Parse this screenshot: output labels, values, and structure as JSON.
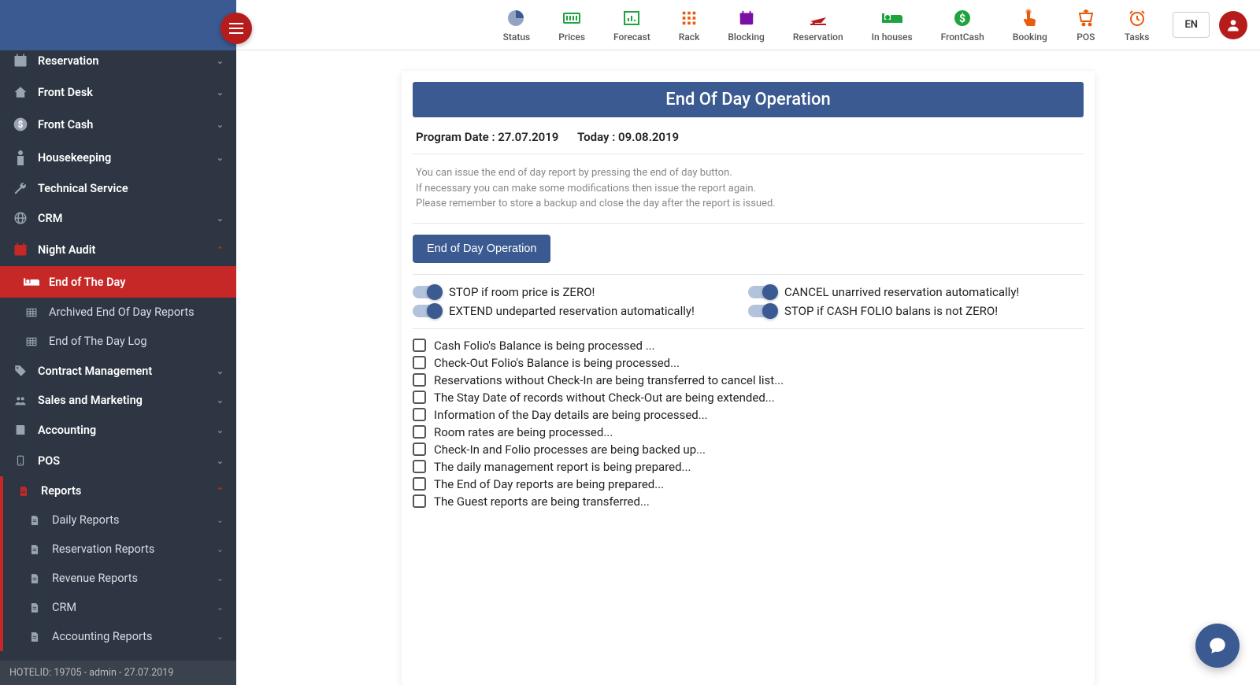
{
  "colors": {
    "brand": "#3b5a91",
    "danger": "#b71c1c",
    "sidebar": "#2d3642"
  },
  "topnav": {
    "items": [
      {
        "label": "Status",
        "icon": "pie",
        "color": "#3b5a91"
      },
      {
        "label": "Prices",
        "icon": "money",
        "color": "#1fa33f"
      },
      {
        "label": "Forecast",
        "icon": "bar",
        "color": "#1fa33f"
      },
      {
        "label": "Rack",
        "icon": "grid",
        "color": "#e85c10"
      },
      {
        "label": "Blocking",
        "icon": "calendar",
        "color": "#7b0fa3"
      },
      {
        "label": "Reservation",
        "icon": "plane",
        "color": "#b71c1c"
      },
      {
        "label": "In houses",
        "icon": "bed",
        "color": "#1fa33f"
      },
      {
        "label": "FrontCash",
        "icon": "dollar",
        "color": "#1fa33f"
      },
      {
        "label": "Booking",
        "icon": "tap",
        "color": "#e85c10"
      },
      {
        "label": "POS",
        "icon": "cart",
        "color": "#e85c10"
      },
      {
        "label": "Tasks",
        "icon": "clock",
        "color": "#e85c10"
      }
    ],
    "lang": "EN"
  },
  "sidebar": {
    "items": [
      {
        "label": "Reservation",
        "icon": "calendar",
        "bold": true,
        "chev": "down"
      },
      {
        "label": "Front Desk",
        "icon": "home",
        "bold": true,
        "chev": "down"
      },
      {
        "label": "Front Cash",
        "icon": "dollar",
        "bold": true,
        "chev": "down"
      },
      {
        "label": "Housekeeping",
        "icon": "person",
        "bold": true,
        "chev": "down"
      },
      {
        "label": "Technical Service",
        "icon": "wrench",
        "bold": true
      },
      {
        "label": "CRM",
        "icon": "globe",
        "bold": true,
        "chev": "down"
      },
      {
        "label": "Night Audit",
        "icon": "calendar",
        "bold": true,
        "chev": "up",
        "expanded": true,
        "danger_icon": true
      },
      {
        "label": "End of The Day",
        "icon": "bed",
        "sub": true,
        "active": true
      },
      {
        "label": "Archived End Of Day Reports",
        "icon": "table",
        "sub": true
      },
      {
        "label": "End of The Day Log",
        "icon": "table",
        "sub": true
      },
      {
        "label": "Contract Management",
        "icon": "tag",
        "bold": true,
        "chev": "down"
      },
      {
        "label": "Sales and Marketing",
        "icon": "people",
        "bold": true,
        "chev": "down"
      },
      {
        "label": "Accounting",
        "icon": "book",
        "bold": true,
        "chev": "down"
      },
      {
        "label": "POS",
        "icon": "device",
        "bold": true,
        "chev": "down"
      },
      {
        "label": "Reports",
        "icon": "doc",
        "bold": true,
        "chev": "up",
        "expanded": true,
        "danger_icon": true,
        "report_strip": true
      },
      {
        "label": "Daily Reports",
        "icon": "doc",
        "sub": true,
        "l2": true,
        "chev": "down"
      },
      {
        "label": "Reservation Reports",
        "icon": "doc",
        "sub": true,
        "l2": true,
        "chev": "down"
      },
      {
        "label": "Revenue Reports",
        "icon": "doc",
        "sub": true,
        "l2": true,
        "chev": "down"
      },
      {
        "label": "CRM",
        "icon": "doc",
        "sub": true,
        "l2": true,
        "chev": "down"
      },
      {
        "label": "Accounting Reports",
        "icon": "doc",
        "sub": true,
        "l2": true,
        "chev": "down"
      }
    ],
    "footer": "HOTELID: 19705 - admin - 27.07.2019"
  },
  "card": {
    "title": "End Of Day Operation",
    "program_date_label": "Program Date : 27.07.2019",
    "today_label": "Today : 09.08.2019",
    "hint1": "You can issue the end of day report by pressing the end of day button.",
    "hint2": "If necessary you can make some modifications then issue the report again.",
    "hint3": "Please remember to store a backup and close the day after the report is issued.",
    "button": "End of Day Operation",
    "toggles_left": [
      "STOP if room price is ZERO!",
      "EXTEND undeparted reservation automatically!"
    ],
    "toggles_right": [
      "CANCEL unarrived reservation automatically!",
      "STOP if CASH FOLIO balans is not ZERO!"
    ],
    "checks": [
      "Cash Folio's Balance is being processed ...",
      "Check-Out Folio's Balance is being processed...",
      "Reservations without Check-In are being transferred to cancel list...",
      "The Stay Date of records without Check-Out are being extended...",
      "Information of the Day details are being processed...",
      "Room rates are being processed...",
      "Check-In and Folio processes are being backed up...",
      "The daily management report is being prepared...",
      "The End of Day reports are being prepared...",
      "The Guest reports are being transferred..."
    ]
  }
}
